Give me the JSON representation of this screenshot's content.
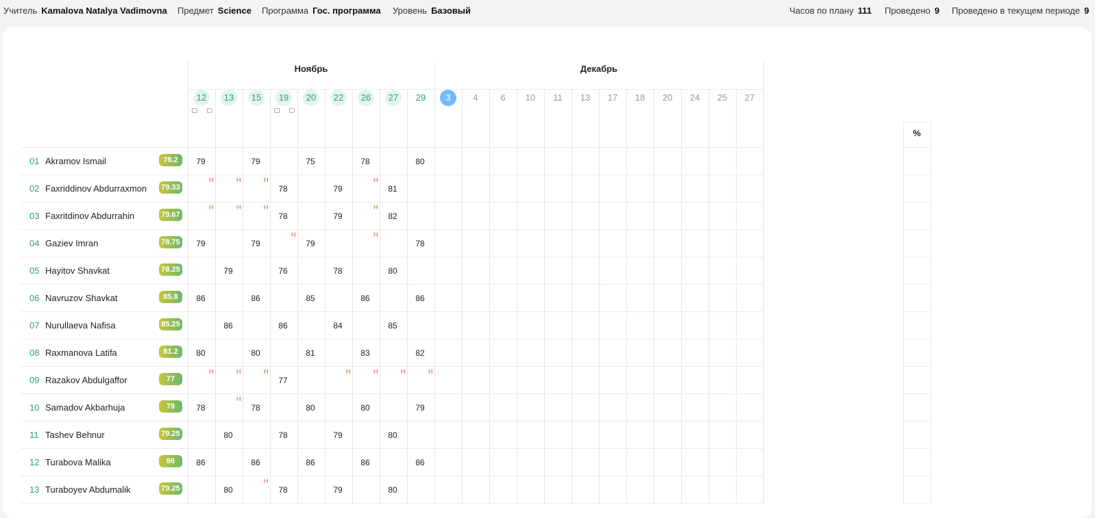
{
  "header": {
    "teacher_label": "Учитель",
    "teacher": "Kamalova Natalya Vadimovna",
    "subject_label": "Предмет",
    "subject": "Science",
    "program_label": "Программа",
    "program": "Гос. программа",
    "level_label": "Уровень",
    "level": "Базовый",
    "hours_label": "Часов по плану",
    "hours": "111",
    "held_label": "Проведено",
    "held": "9",
    "held_period_label": "Проведено в текущем периоде",
    "held_period": "9"
  },
  "months": [
    "Ноябрь",
    "Декабрь"
  ],
  "days": [
    {
      "d": "12",
      "m": 0,
      "state": "active",
      "icons": true
    },
    {
      "d": "13",
      "m": 0,
      "state": "active",
      "icons": false
    },
    {
      "d": "15",
      "m": 0,
      "state": "active",
      "icons": false
    },
    {
      "d": "19",
      "m": 0,
      "state": "active",
      "icons": true
    },
    {
      "d": "20",
      "m": 0,
      "state": "active",
      "icons": false
    },
    {
      "d": "22",
      "m": 0,
      "state": "active",
      "icons": false
    },
    {
      "d": "26",
      "m": 0,
      "state": "active",
      "icons": false
    },
    {
      "d": "27",
      "m": 0,
      "state": "active",
      "icons": false
    },
    {
      "d": "29",
      "m": 0,
      "state": "plain",
      "icons": false
    },
    {
      "d": "3",
      "m": 1,
      "state": "today",
      "icons": false
    },
    {
      "d": "4",
      "m": 1,
      "state": "inactive",
      "icons": false
    },
    {
      "d": "6",
      "m": 1,
      "state": "inactive",
      "icons": false
    },
    {
      "d": "10",
      "m": 1,
      "state": "inactive",
      "icons": false
    },
    {
      "d": "11",
      "m": 1,
      "state": "inactive",
      "icons": false
    },
    {
      "d": "13",
      "m": 1,
      "state": "inactive",
      "icons": false
    },
    {
      "d": "17",
      "m": 1,
      "state": "inactive",
      "icons": false
    },
    {
      "d": "18",
      "m": 1,
      "state": "inactive",
      "icons": false
    },
    {
      "d": "20",
      "m": 1,
      "state": "inactive",
      "icons": false
    },
    {
      "d": "24",
      "m": 1,
      "state": "inactive",
      "icons": false
    },
    {
      "d": "25",
      "m": 1,
      "state": "inactive",
      "icons": false
    },
    {
      "d": "27",
      "m": 1,
      "state": "inactive",
      "icons": false
    }
  ],
  "percent_header": "%",
  "absent_mark": "Н",
  "students": [
    {
      "num": "01",
      "name": "Akramov Ismail",
      "avg": "78.2",
      "grades": [
        "79",
        "",
        "79",
        "",
        "75",
        "",
        "78",
        "",
        "80"
      ],
      "absent": []
    },
    {
      "num": "02",
      "name": "Faxriddinov Abdurraxmon",
      "avg": "79.33",
      "grades": [
        "",
        "",
        "",
        "78",
        "",
        "79",
        "",
        "81",
        ""
      ],
      "absent": [
        0,
        1,
        2,
        6
      ]
    },
    {
      "num": "03",
      "name": "Faxritdinov Abdurrahin",
      "avg": "79.67",
      "grades": [
        "",
        "",
        "",
        "78",
        "",
        "79",
        "",
        "82",
        ""
      ],
      "absent": [
        0,
        1,
        2,
        6
      ]
    },
    {
      "num": "04",
      "name": "Gaziev Imran",
      "avg": "78.75",
      "grades": [
        "79",
        "",
        "79",
        "",
        "79",
        "",
        "",
        "",
        "78"
      ],
      "absent": [
        3,
        6
      ]
    },
    {
      "num": "05",
      "name": "Hayitov Shavkat",
      "avg": "78.25",
      "grades": [
        "",
        "79",
        "",
        "76",
        "",
        "78",
        "",
        "80",
        ""
      ],
      "absent": []
    },
    {
      "num": "06",
      "name": "Navruzov Shavkat",
      "avg": "85.8",
      "grades": [
        "86",
        "",
        "86",
        "",
        "85",
        "",
        "86",
        "",
        "86"
      ],
      "absent": []
    },
    {
      "num": "07",
      "name": "Nurullaeva Nafisa",
      "avg": "85.25",
      "grades": [
        "",
        "86",
        "",
        "86",
        "",
        "84",
        "",
        "85",
        ""
      ],
      "absent": []
    },
    {
      "num": "08",
      "name": "Raxmanova Latifa",
      "avg": "81.2",
      "grades": [
        "80",
        "",
        "80",
        "",
        "81",
        "",
        "83",
        "",
        "82"
      ],
      "absent": []
    },
    {
      "num": "09",
      "name": "Razakov Abdulgaffor",
      "avg": "77",
      "grades": [
        "",
        "",
        "",
        "77",
        "",
        "",
        "",
        "",
        ""
      ],
      "absent": [
        0,
        1,
        2,
        5,
        6,
        7,
        8
      ]
    },
    {
      "num": "10",
      "name": "Samadov Akbarhuja",
      "avg": "79",
      "grades": [
        "78",
        "",
        "78",
        "",
        "80",
        "",
        "80",
        "",
        "79"
      ],
      "absent": [
        1
      ]
    },
    {
      "num": "11",
      "name": "Tashev Behnur",
      "avg": "79.25",
      "grades": [
        "",
        "80",
        "",
        "78",
        "",
        "79",
        "",
        "80",
        ""
      ],
      "absent": []
    },
    {
      "num": "12",
      "name": "Turabova Malika",
      "avg": "86",
      "grades": [
        "86",
        "",
        "86",
        "",
        "86",
        "",
        "86",
        "",
        "86"
      ],
      "absent": []
    },
    {
      "num": "13",
      "name": "Turaboyev Abdumalik",
      "avg": "79.25",
      "grades": [
        "",
        "80",
        "",
        "78",
        "",
        "79",
        "",
        "80",
        ""
      ],
      "absent": [
        2
      ]
    }
  ],
  "colors": {
    "accent": "#2d9c83",
    "absent": "#e8583c",
    "today": "#74b9ff",
    "avg_start": "#c6c83a",
    "avg_end": "#6bb86a"
  }
}
